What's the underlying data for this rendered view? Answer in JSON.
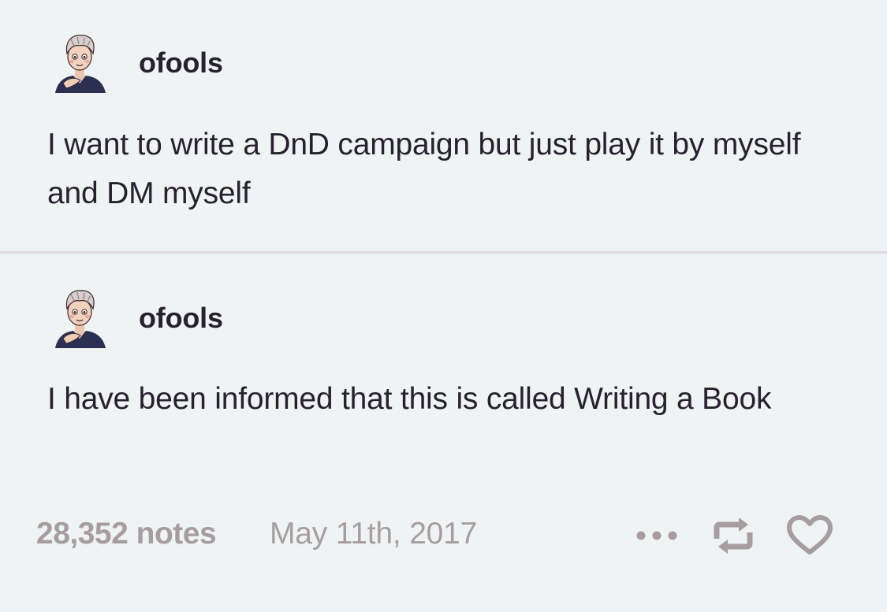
{
  "posts": [
    {
      "username": "ofools",
      "avatar_icon": "avatar-icon",
      "text": "I want to write a DnD campaign but just play it by myself and DM myself"
    },
    {
      "username": "ofools",
      "avatar_icon": "avatar-icon",
      "text": "I have been informed that this is called Writing a Book"
    }
  ],
  "footer": {
    "notes": "28,352 notes",
    "date": "May 11th, 2017",
    "more_icon": "more-options-icon",
    "reblog_icon": "reblog-icon",
    "like_icon": "heart-icon"
  },
  "colors": {
    "background": "#eff3f4",
    "text": "#27212e",
    "meta": "#a79d9f",
    "divider": "#ddd9dc"
  }
}
